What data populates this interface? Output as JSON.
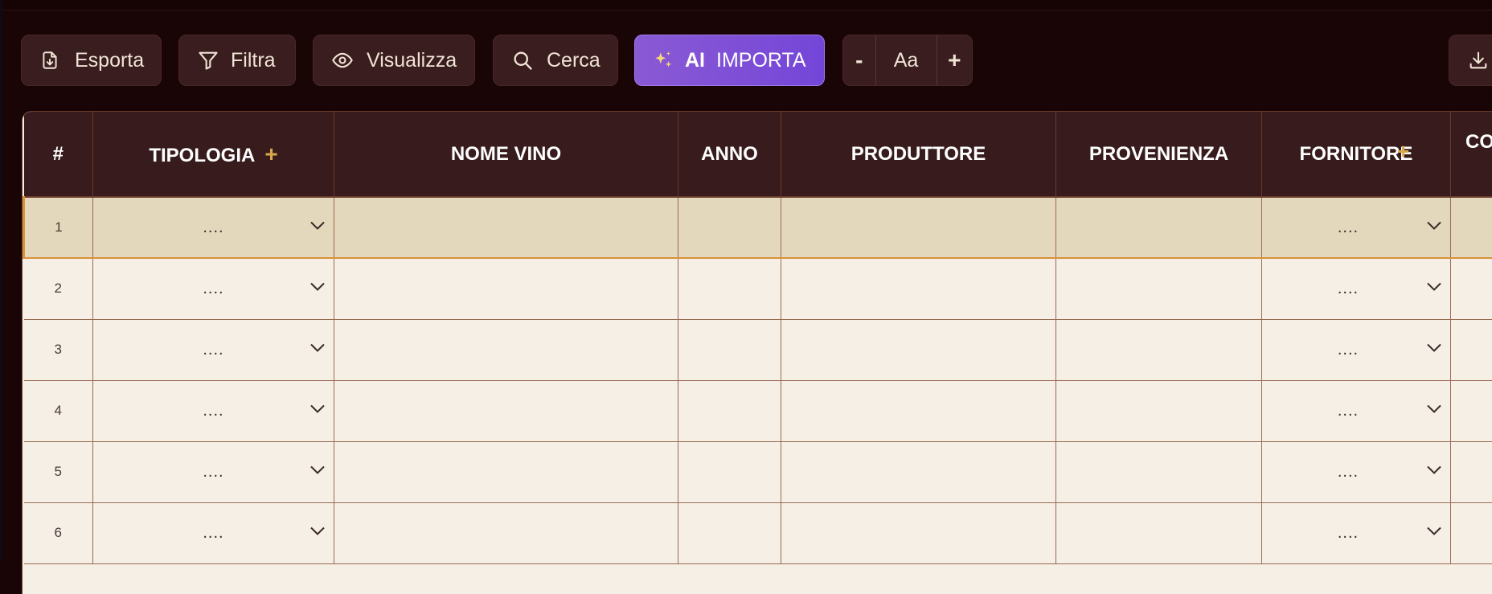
{
  "toolbar": {
    "export_label": "Esporta",
    "filter_label": "Filtra",
    "view_label": "Visualizza",
    "search_label": "Cerca",
    "ai_label": "AI",
    "import_label": "IMPORTA",
    "font_decrease": "-",
    "font_label": "Aa",
    "font_increase": "+"
  },
  "table": {
    "headers": {
      "index": "#",
      "tipologia": "TIPOLOGIA",
      "tipologia_add": "+",
      "nome_vino": "NOME VINO",
      "anno": "ANNO",
      "produttore": "PRODUTTORE",
      "provenienza": "PROVENIENZA",
      "fornitore": "FORNITORE",
      "fornitore_add": "+",
      "next_partial": "CO"
    },
    "placeholder": "....",
    "rows": [
      {
        "n": "1"
      },
      {
        "n": "2"
      },
      {
        "n": "3"
      },
      {
        "n": "4"
      },
      {
        "n": "5"
      },
      {
        "n": "6"
      }
    ]
  },
  "colors": {
    "accent": "#d9a84a",
    "selected_row": "#e3d8bc",
    "header_bg": "#381c1d",
    "ai_gradient_start": "#8a5ad4",
    "ai_gradient_end": "#7446d8"
  }
}
